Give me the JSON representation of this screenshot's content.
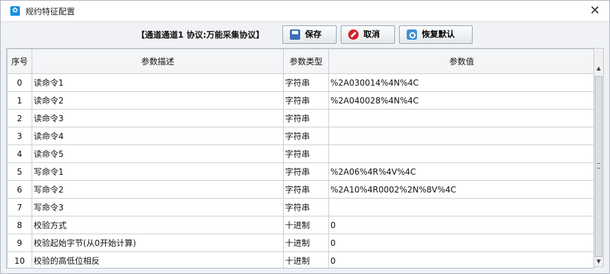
{
  "window": {
    "title": "规约特征配置",
    "close_glyph": "✕"
  },
  "toolbar": {
    "channel_label": "【通道通道1  协议:万能采集协议】",
    "save_label": "保存",
    "cancel_label": "取消",
    "reset_label": "恢复默认"
  },
  "table": {
    "headers": [
      "序号",
      "参数描述",
      "参数类型",
      "参数值"
    ],
    "rows": [
      {
        "seq": "0",
        "desc": "读命令1",
        "type": "字符串",
        "value": "%2A030014%4N%4C"
      },
      {
        "seq": "1",
        "desc": "读命令2",
        "type": "字符串",
        "value": "%2A040028%4N%4C"
      },
      {
        "seq": "2",
        "desc": "读命令3",
        "type": "字符串",
        "value": ""
      },
      {
        "seq": "3",
        "desc": "读命令4",
        "type": "字符串",
        "value": ""
      },
      {
        "seq": "4",
        "desc": "读命令5",
        "type": "字符串",
        "value": ""
      },
      {
        "seq": "5",
        "desc": "写命令1",
        "type": "字符串",
        "value": "%2A06%4R%4V%4C"
      },
      {
        "seq": "6",
        "desc": "写命令2",
        "type": "字符串",
        "value": "%2A10%4R0002%2N%8V%4C"
      },
      {
        "seq": "7",
        "desc": "写命令3",
        "type": "字符串",
        "value": ""
      },
      {
        "seq": "8",
        "desc": "校验方式",
        "type": "十进制",
        "value": "0"
      },
      {
        "seq": "9",
        "desc": "校验起始字节(从0开始计算)",
        "type": "十进制",
        "value": "0"
      },
      {
        "seq": "10",
        "desc": "校验的高低位相反",
        "type": "十进制",
        "value": "0"
      }
    ]
  },
  "icons": {
    "app": "gear-icon",
    "save": "floppy-disk-icon",
    "cancel": "no-entry-icon",
    "reset": "restore-icon"
  },
  "colors": {
    "accent": "#1a8fe3",
    "cancel_red": "#d2202a",
    "save_blue": "#3a6fb6"
  }
}
